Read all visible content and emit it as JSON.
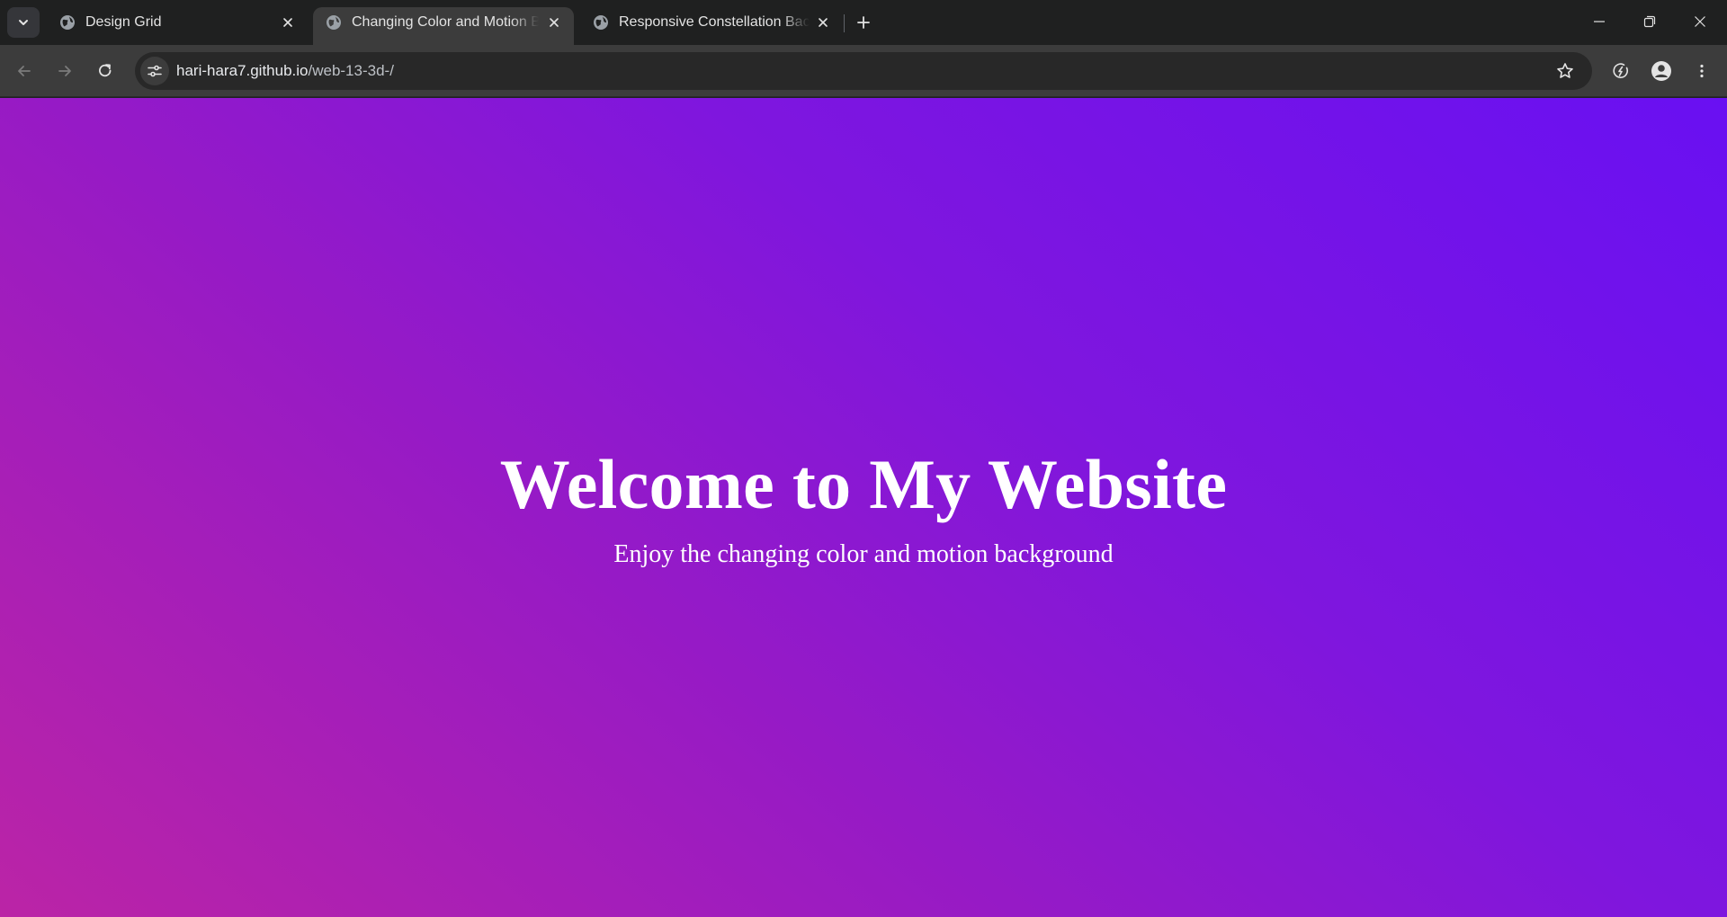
{
  "browser": {
    "tabs": [
      {
        "title": "Design Grid",
        "active": false
      },
      {
        "title": "Changing Color and Motion Background",
        "active": true
      },
      {
        "title": "Responsive Constellation Background",
        "active": false
      }
    ],
    "address_bar": {
      "host": "hari-hara7.github.io",
      "path": "/web-13-3d-/"
    }
  },
  "page": {
    "title": "Welcome to My Website",
    "subtitle": "Enjoy the changing color and motion background",
    "background_colors": [
      "#bb24a6",
      "#961ac6",
      "#7f16de",
      "#6910f2"
    ]
  },
  "colors": {
    "tabstrip_bg": "#1f2020",
    "toolbar_bg": "#3c3c3c",
    "omnibox_bg": "#282828",
    "text": "#e3e3e3"
  }
}
